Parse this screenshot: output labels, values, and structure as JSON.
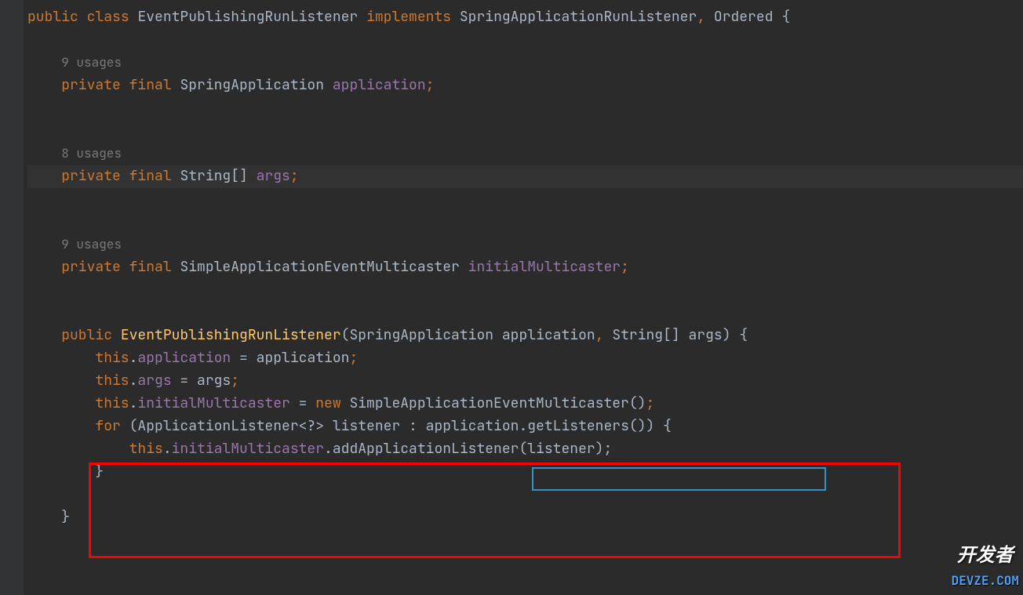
{
  "code": {
    "line1": {
      "kw_public": "public",
      "kw_class": "class",
      "class_name": "EventPublishingRunListener",
      "kw_implements": "implements",
      "interface1": "SpringApplicationRunListener",
      "interface2": "Ordered",
      "brace": " {"
    },
    "usage1": "9 usages",
    "field1": {
      "kw_private": "private",
      "kw_final": "final",
      "type": "SpringApplication",
      "name": "application",
      "semi": ";"
    },
    "usage2": "8 usages",
    "field2": {
      "kw_private": "private",
      "kw_final": "final",
      "type": "String[]",
      "name": "args",
      "semi": ";"
    },
    "usage3": "9 usages",
    "field3": {
      "kw_private": "private",
      "kw_final": "final",
      "type": "SimpleApplicationEventMulticaster",
      "name": "initialMulticaster",
      "semi": ";"
    },
    "ctor": {
      "kw_public": "public",
      "name": "EventPublishingRunListener",
      "param1_type": "SpringApplication",
      "param1_name": "application",
      "param2_type": "String[]",
      "param2_name": "args",
      "brace": ") {"
    },
    "body1": {
      "kw_this": "this",
      "field": "application",
      "eq": " = ",
      "val": "application",
      "semi": ";"
    },
    "body2": {
      "kw_this": "this",
      "field": "args",
      "eq": " = ",
      "val": "args",
      "semi": ";"
    },
    "body3": {
      "kw_this": "this",
      "field": "initialMulticaster",
      "eq": " = ",
      "kw_new": "new",
      "type": "SimpleApplicationEventMulticaster",
      "parens": "()",
      "semi": ";"
    },
    "for_loop": {
      "kw_for": "for",
      "open": " (",
      "type": "ApplicationListener<?>",
      "var": "listener",
      "colon": " : ",
      "obj": "application",
      "method": "getListeners",
      "close": "()) {"
    },
    "for_body": {
      "kw_this": "this",
      "field": "initialMulticaster",
      "method": "addApplicationListener",
      "arg": "listener",
      "close": ");"
    },
    "close_brace1": "}",
    "close_brace2": "}"
  },
  "watermark": {
    "cn": "开发者",
    "en": "DEVZE.COM"
  }
}
